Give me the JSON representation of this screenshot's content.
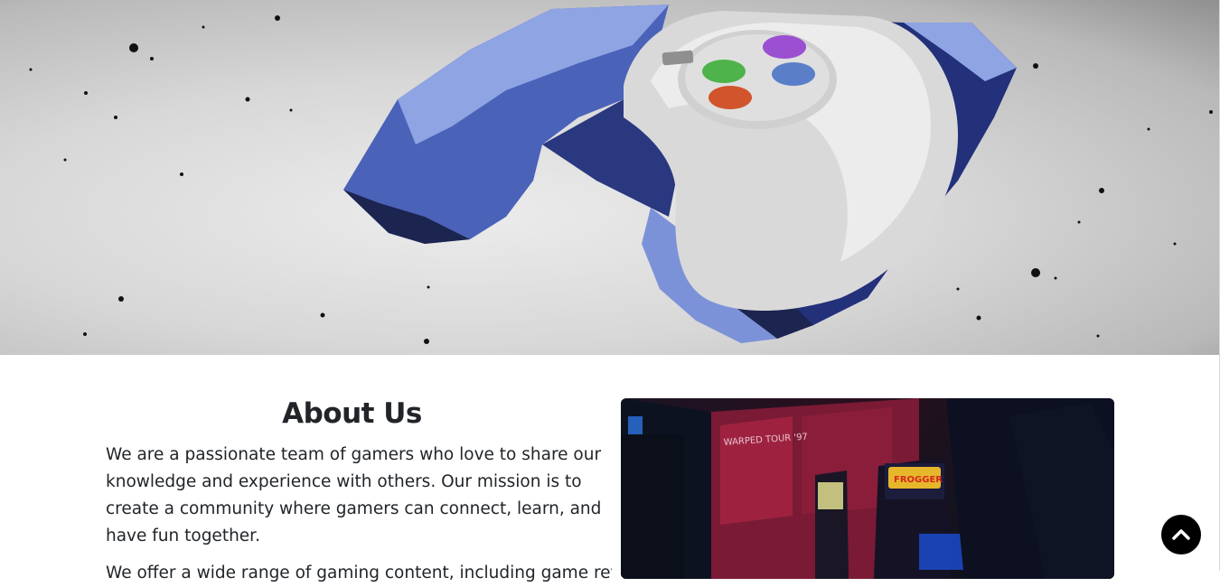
{
  "hero": {
    "icon": "game-controller-image"
  },
  "about": {
    "title": "About Us",
    "paragraph_1": "We are a passionate team of gamers who love to share our knowledge and experience with others. Our mission is to create a community where gamers can connect, learn, and have fun together.",
    "paragraph_2": "We offer a wide range of gaming content, including game reviews, tutorials"
  },
  "arcade": {
    "image": "arcade-photo",
    "sign_text": "FROGGER",
    "poster_text": "WARPED TOUR '97"
  },
  "back_to_top": {
    "icon": "chevron-up-icon"
  }
}
